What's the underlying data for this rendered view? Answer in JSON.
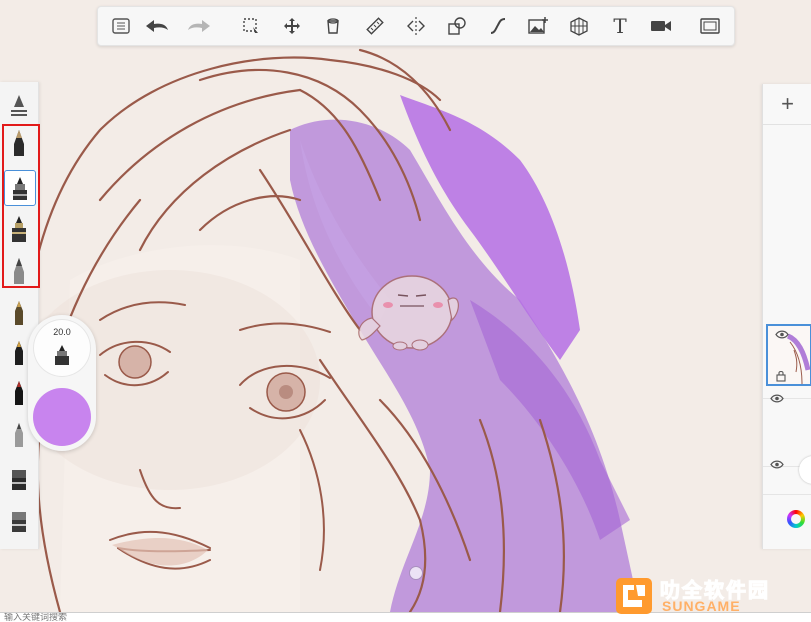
{
  "toolbar": {
    "items": [
      {
        "name": "menu-icon"
      },
      {
        "name": "undo-icon"
      },
      {
        "name": "redo-icon"
      },
      {
        "name": "selection-icon"
      },
      {
        "name": "move-icon"
      },
      {
        "name": "bucket-icon"
      },
      {
        "name": "ruler-icon"
      },
      {
        "name": "symmetry-icon"
      },
      {
        "name": "shapes-icon"
      },
      {
        "name": "curve-icon"
      },
      {
        "name": "add-image-icon"
      },
      {
        "name": "perspective-icon"
      },
      {
        "name": "text-icon",
        "label": "T"
      },
      {
        "name": "record-icon"
      },
      {
        "name": "fullscreen-icon"
      }
    ]
  },
  "brushes": [
    {
      "name": "brush-adjust"
    },
    {
      "name": "brush-pencil"
    },
    {
      "name": "brush-marker",
      "selected": true
    },
    {
      "name": "brush-airbrush"
    },
    {
      "name": "brush-soft-pencil"
    },
    {
      "name": "brush-fineliner"
    },
    {
      "name": "brush-ink-pen"
    },
    {
      "name": "brush-calligraphy"
    },
    {
      "name": "brush-chisel"
    },
    {
      "name": "brush-eraser"
    },
    {
      "name": "brush-block-eraser"
    }
  ],
  "brush_panel": {
    "size": "20.0",
    "color": "#c884ee"
  },
  "layers": {
    "add_label": "+",
    "selected_index": 0
  },
  "bottom": {
    "search_hint": "输入关键词搜索"
  },
  "watermark": {
    "text": "叻全软件园",
    "sub": "SUNGAME"
  },
  "colors": {
    "accent": "#4a90d9",
    "highlight": "#e21a1a",
    "paint": "#c884ee"
  }
}
